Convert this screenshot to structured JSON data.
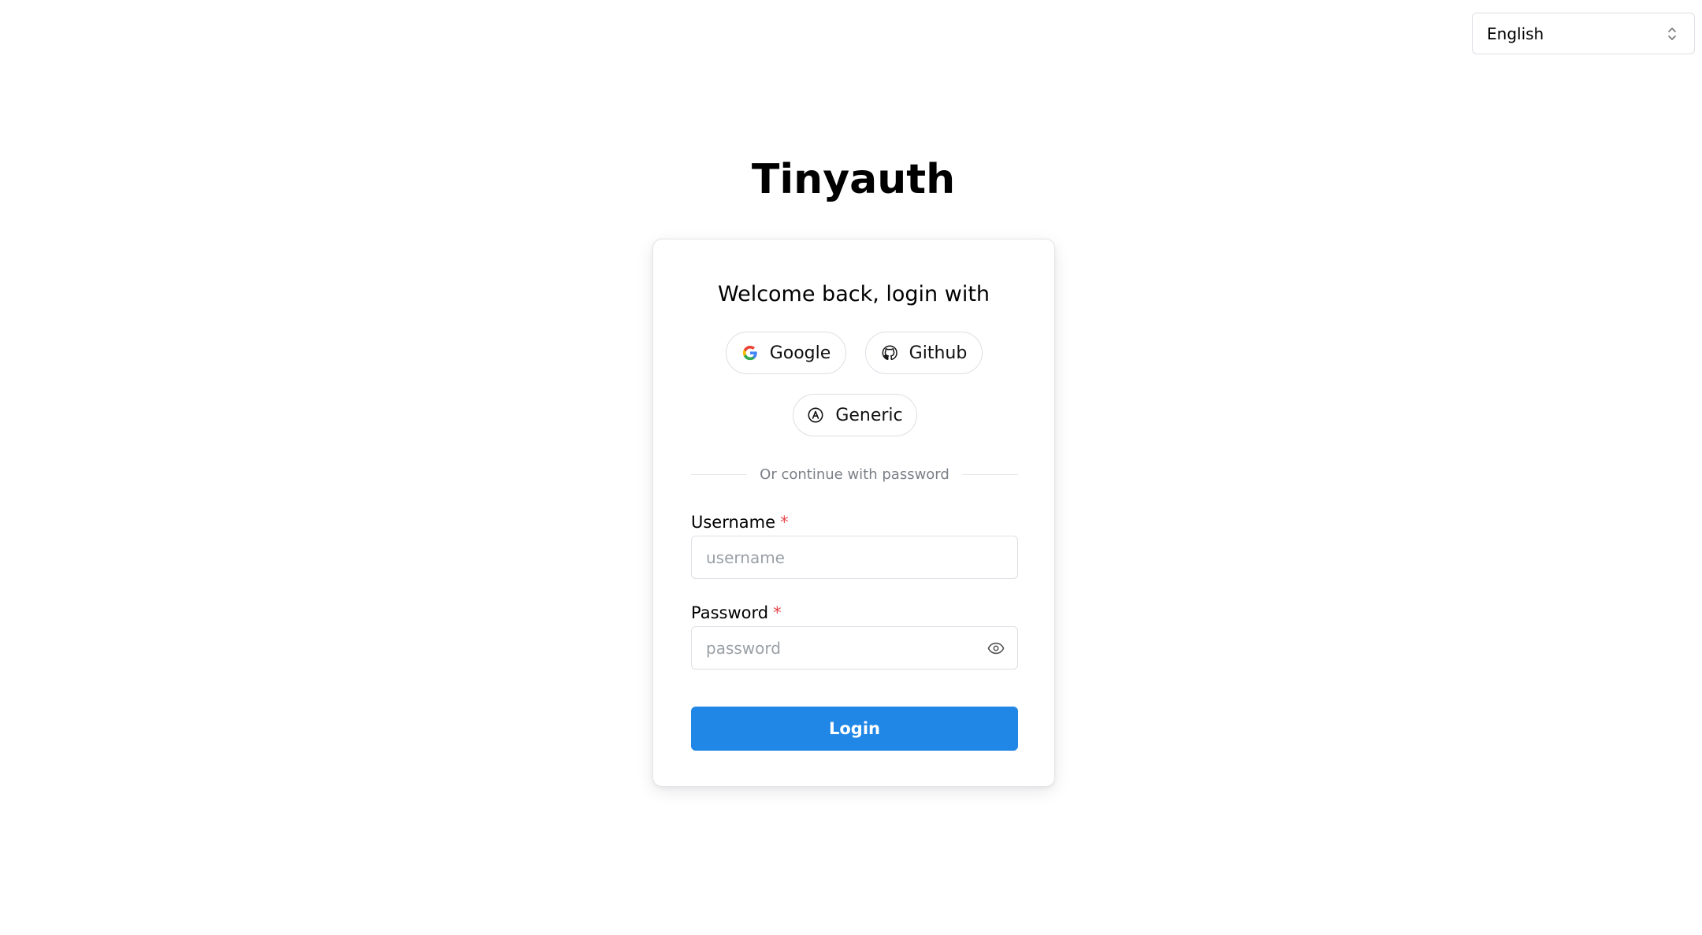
{
  "language_select": {
    "selected": "English",
    "icon": "chevron-up-down-icon"
  },
  "app": {
    "title": "Tinyauth"
  },
  "login_card": {
    "heading": "Welcome back, login with",
    "oauth_buttons": [
      {
        "label": "Google",
        "icon": "google-icon"
      },
      {
        "label": "Github",
        "icon": "github-icon"
      },
      {
        "label": "Generic",
        "icon": "at-sign-icon"
      }
    ],
    "divider_text": "Or continue with password",
    "username": {
      "label": "Username",
      "required_marker": "*",
      "placeholder": "username",
      "value": ""
    },
    "password": {
      "label": "Password",
      "required_marker": "*",
      "placeholder": "password",
      "value": "",
      "toggle_icon": "eye-icon"
    },
    "submit_label": "Login"
  },
  "colors": {
    "primary": "#2187e6",
    "required": "#e5484d",
    "border": "#dcdfe4",
    "muted_text": "#7b7f86"
  }
}
